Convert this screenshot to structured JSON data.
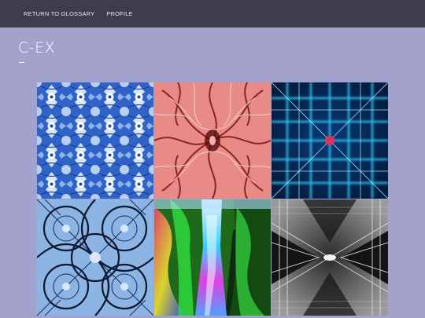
{
  "nav": {
    "return_label": "RETURN TO GLOSSARY",
    "profile_label": "PROFILE"
  },
  "page": {
    "title": "C-EX"
  },
  "colors": {
    "topbar": "#3e3d4d",
    "background": "#a3a2cc"
  },
  "gallery": {
    "tiles": [
      {
        "icon": "blue-white-kaleidoscope-image"
      },
      {
        "icon": "red-branching-kaleidoscope-image"
      },
      {
        "icon": "neon-blue-grid-image"
      },
      {
        "icon": "blue-black-lattice-image"
      },
      {
        "icon": "psychedelic-waterfall-image"
      },
      {
        "icon": "grayscale-mirrored-architecture-image"
      }
    ]
  }
}
